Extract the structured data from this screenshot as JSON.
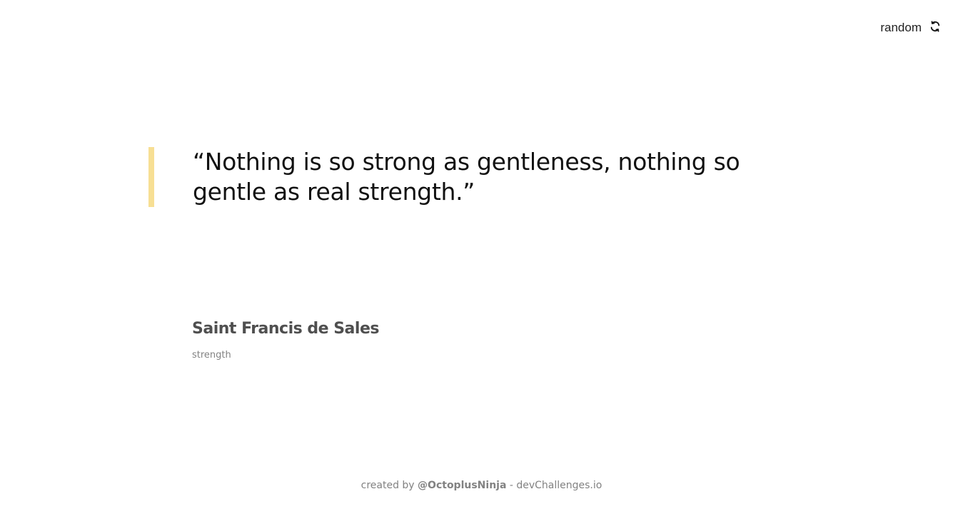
{
  "header": {
    "random_label": "random",
    "random_icon": "refresh-icon"
  },
  "quote": {
    "text": "“Nothing is so strong as gentleness, nothing so gentle as real strength.”",
    "accent_color": "#F7DF94"
  },
  "author": {
    "name": "Saint Francis de Sales",
    "genre": "strength"
  },
  "footer": {
    "prefix": "created by",
    "username": "@OctoplusNinja",
    "separator": " - ",
    "site": "devChallenges.io"
  }
}
